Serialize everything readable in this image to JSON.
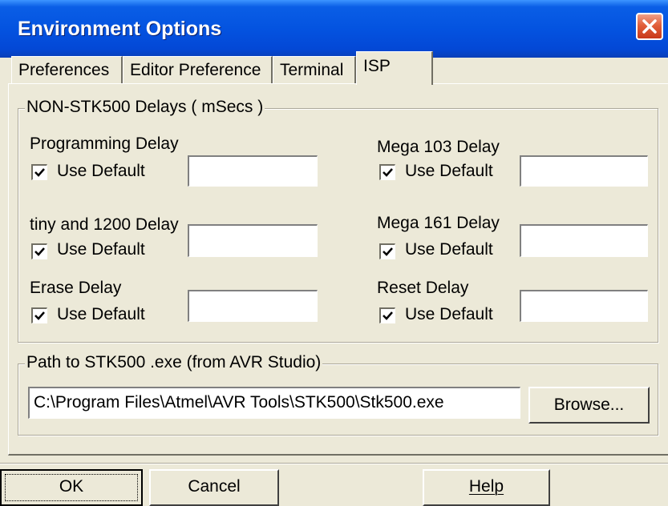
{
  "window": {
    "title": "Environment Options"
  },
  "tabs": [
    {
      "label": "Preferences",
      "active": false
    },
    {
      "label": "Editor Preference",
      "active": false
    },
    {
      "label": "Terminal",
      "active": false
    },
    {
      "label": "ISP",
      "active": true
    }
  ],
  "delays_group": {
    "title": "NON-STK500 Delays ( mSecs )",
    "fields": [
      {
        "label": "Programming Delay",
        "checkbox_label": "Use Default",
        "checked": true,
        "value": ""
      },
      {
        "label": "Mega 103 Delay",
        "checkbox_label": "Use Default",
        "checked": true,
        "value": ""
      },
      {
        "label": "tiny and 1200 Delay",
        "checkbox_label": "Use Default",
        "checked": true,
        "value": ""
      },
      {
        "label": "Mega 161 Delay",
        "checkbox_label": "Use Default",
        "checked": true,
        "value": ""
      },
      {
        "label": "Erase Delay",
        "checkbox_label": "Use Default",
        "checked": true,
        "value": ""
      },
      {
        "label": "Reset Delay",
        "checkbox_label": "Use Default",
        "checked": true,
        "value": ""
      }
    ]
  },
  "path_group": {
    "title": "Path to STK500 .exe (from AVR Studio)",
    "path_value": "C:\\Program Files\\Atmel\\AVR Tools\\STK500\\Stk500.exe",
    "browse_label": "Browse..."
  },
  "buttons": {
    "ok": "OK",
    "cancel": "Cancel",
    "help": "Help"
  },
  "colors": {
    "titlebar": "#0453e0",
    "face": "#ece9d8",
    "close": "#e25f3a"
  }
}
